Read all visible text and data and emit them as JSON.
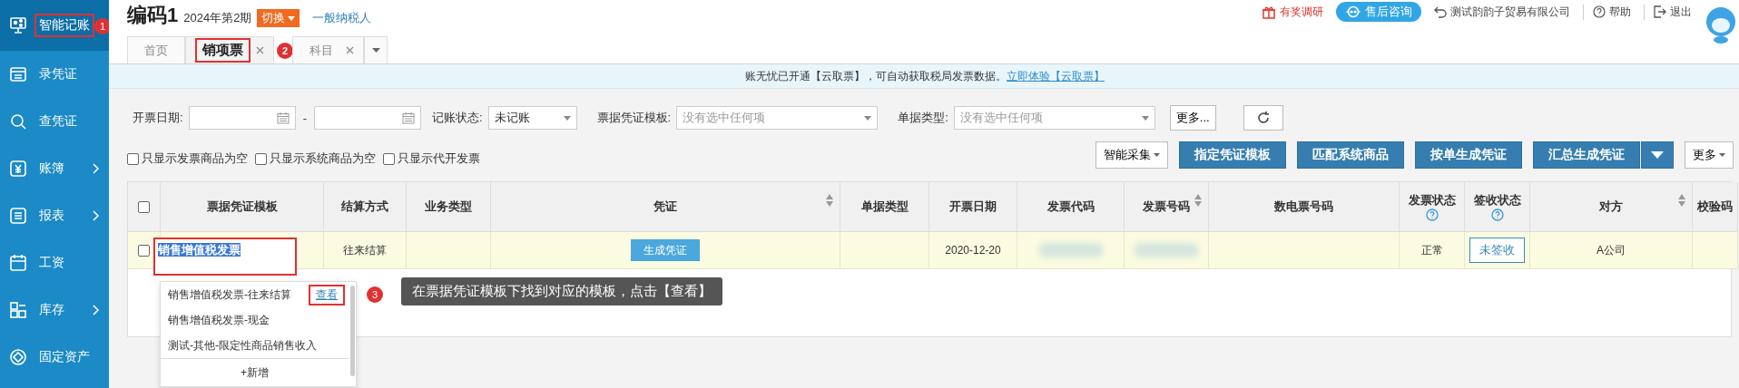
{
  "sidebar": {
    "items": [
      {
        "label": "智能记账",
        "selected": true,
        "has_submenu": false,
        "highlighted": true,
        "callout": "1"
      },
      {
        "label": "录凭证",
        "selected": false,
        "has_submenu": false,
        "highlighted": false
      },
      {
        "label": "查凭证",
        "selected": false,
        "has_submenu": false,
        "highlighted": false
      },
      {
        "label": "账簿",
        "selected": false,
        "has_submenu": true,
        "highlighted": false
      },
      {
        "label": "报表",
        "selected": false,
        "has_submenu": true,
        "highlighted": false
      },
      {
        "label": "工资",
        "selected": false,
        "has_submenu": false,
        "highlighted": false
      },
      {
        "label": "库存",
        "selected": false,
        "has_submenu": true,
        "highlighted": false
      },
      {
        "label": "固定资产",
        "selected": false,
        "has_submenu": false,
        "highlighted": false
      }
    ]
  },
  "header": {
    "title": "编码1",
    "period": "2024年第2期",
    "switch_button": "切换",
    "taxpayer_link": "一般纳税人",
    "links": [
      {
        "kind": "survey",
        "label": "有奖调研"
      },
      {
        "kind": "consult",
        "label": "售后咨询"
      },
      {
        "kind": "company",
        "label": "测试韵韵子贸易有限公司"
      },
      {
        "kind": "help",
        "label": "帮助"
      },
      {
        "kind": "logout",
        "label": "退出"
      }
    ]
  },
  "tabs": [
    {
      "label": "首页",
      "selected": false,
      "closable": false,
      "highlighted": false
    },
    {
      "label": "销项票",
      "selected": true,
      "closable": true,
      "highlighted": true,
      "callout": "2"
    },
    {
      "label": "科目",
      "selected": false,
      "closable": true,
      "highlighted": false
    }
  ],
  "notice": {
    "text": "账无忧已开通【云取票】，可自动获取税局发票数据。",
    "link": "立即体验【云取票】"
  },
  "filters": {
    "date_label": "开票日期:",
    "date_separator": "-",
    "status_label": "记账状态:",
    "status_value": "未记账",
    "template_label": "票据凭证模板:",
    "template_placeholder": "没有选中任何项",
    "type_label": "单据类型:",
    "type_placeholder": "没有选中任何项",
    "more_button": "更多..."
  },
  "checkboxes": [
    {
      "label": "只显示发票商品为空",
      "checked": false
    },
    {
      "label": "只显示系统商品为空",
      "checked": false
    },
    {
      "label": "只显示代开发票",
      "checked": false
    }
  ],
  "toolbar": [
    {
      "kind": "dropdown",
      "label": "智能采集"
    },
    {
      "kind": "primary",
      "label": "指定凭证模板"
    },
    {
      "kind": "primary",
      "label": "匹配系统商品"
    },
    {
      "kind": "primary",
      "label": "按单生成凭证"
    },
    {
      "kind": "primary",
      "label": "汇总生成凭证"
    },
    {
      "kind": "primary-caret"
    },
    {
      "kind": "dropdown",
      "label": "更多"
    }
  ],
  "table": {
    "columns": [
      {
        "kind": "checkbox",
        "checked": false
      },
      {
        "label": "票据凭证模板"
      },
      {
        "label": "结算方式"
      },
      {
        "label": "业务类型"
      },
      {
        "label": "凭证",
        "sortable": true
      },
      {
        "label": "单据类型"
      },
      {
        "label": "开票日期"
      },
      {
        "label": "发票代码"
      },
      {
        "label": "发票号码",
        "sortable": true
      },
      {
        "label": "数电票号码"
      },
      {
        "label": "发票状态",
        "help": true
      },
      {
        "label": "签收状态",
        "help": true
      },
      {
        "label": "对方",
        "sortable": true
      },
      {
        "label": "校验码"
      }
    ],
    "rows": [
      {
        "selected": false,
        "cells": [
          {
            "kind": "checkbox",
            "checked": false
          },
          {
            "kind": "input",
            "value": "销售增值税发票",
            "highlighted": true
          },
          {
            "kind": "text",
            "text": "往来结算"
          },
          {
            "kind": "empty"
          },
          {
            "kind": "button",
            "text": "生成凭证"
          },
          {
            "kind": "empty"
          },
          {
            "kind": "text",
            "text": "2020-12-20"
          },
          {
            "kind": "redacted"
          },
          {
            "kind": "redacted"
          },
          {
            "kind": "empty"
          },
          {
            "kind": "text",
            "text": "正常"
          },
          {
            "kind": "tag",
            "text": "未签收"
          },
          {
            "kind": "text",
            "text": "A公司"
          },
          {
            "kind": "empty"
          }
        ]
      }
    ]
  },
  "template_dropdown": {
    "items": [
      {
        "label": "销售增值税发票-往来结算",
        "action": "查看",
        "highlighted": true,
        "callout": "3"
      },
      {
        "label": "销售增值税发票-现金"
      },
      {
        "label": "测试-其他-限定性商品销售收入"
      }
    ],
    "add_label": "+新增"
  },
  "tooltip": "在票据凭证模板下找到对应的模板，点击【查看】"
}
